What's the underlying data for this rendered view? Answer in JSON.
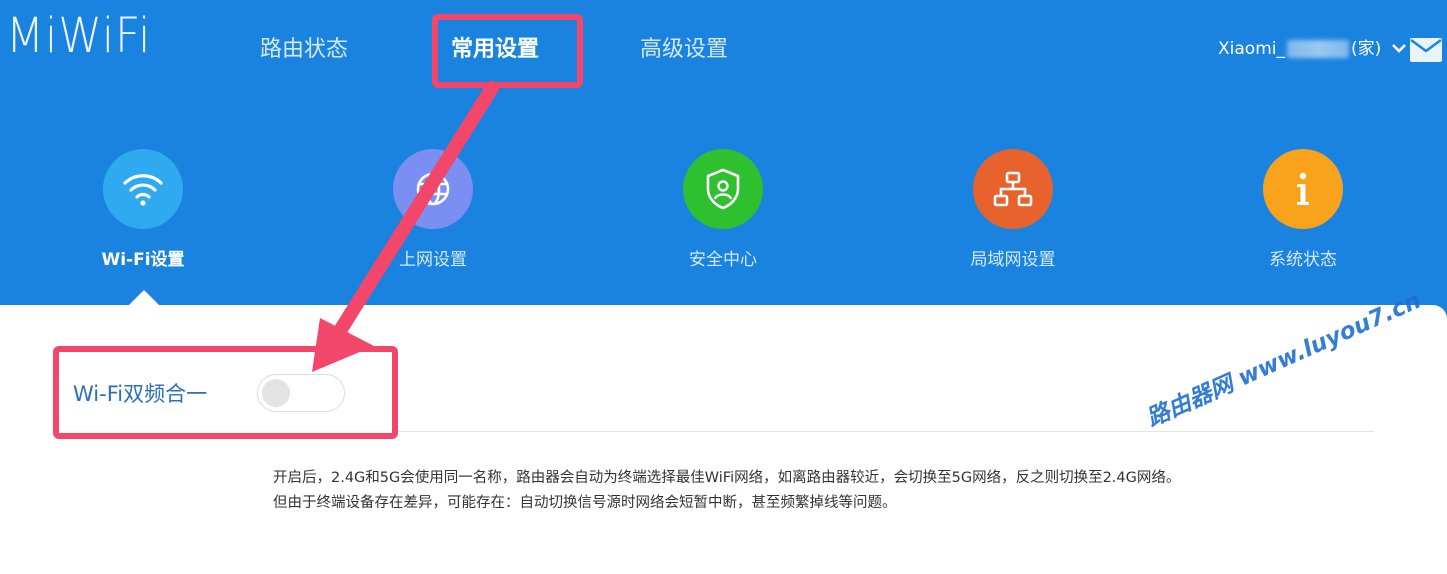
{
  "header": {
    "logo": "MiWiFi",
    "nav": [
      {
        "label": "路由状态"
      },
      {
        "label": "常用设置"
      },
      {
        "label": "高级设置"
      }
    ],
    "user": {
      "prefix": "Xiaomi_",
      "suffix": "(家)"
    }
  },
  "features": [
    {
      "label": "Wi-Fi设置",
      "icon": "wifi-icon",
      "color": "#2fa9f0"
    },
    {
      "label": "上网设置",
      "icon": "globe-icon",
      "color": "#7b8ef2"
    },
    {
      "label": "安全中心",
      "icon": "shield-icon",
      "color": "#2ec02e"
    },
    {
      "label": "局域网设置",
      "icon": "network-icon",
      "color": "#e8622e"
    },
    {
      "label": "系统状态",
      "icon": "info-icon",
      "color": "#f9a21c"
    }
  ],
  "setting": {
    "label": "Wi-Fi双频合一",
    "toggle_on": false,
    "description_line1": "开启后，2.4G和5G会使用同一名称，路由器会自动为终端选择最佳WiFi网络，如离路由器较近，会切换至5G网络，反之则切换至2.4G网络。",
    "description_line2": "但由于终端设备存在差异，可能存在：自动切换信号源时网络会短暂中断，甚至频繁掉线等问题。"
  },
  "watermark": "路由器网 www.luyou7.cn",
  "colors": {
    "header_bg": "#1a83e0",
    "highlight": "#f2476a",
    "label_blue": "#2a6fb8"
  }
}
